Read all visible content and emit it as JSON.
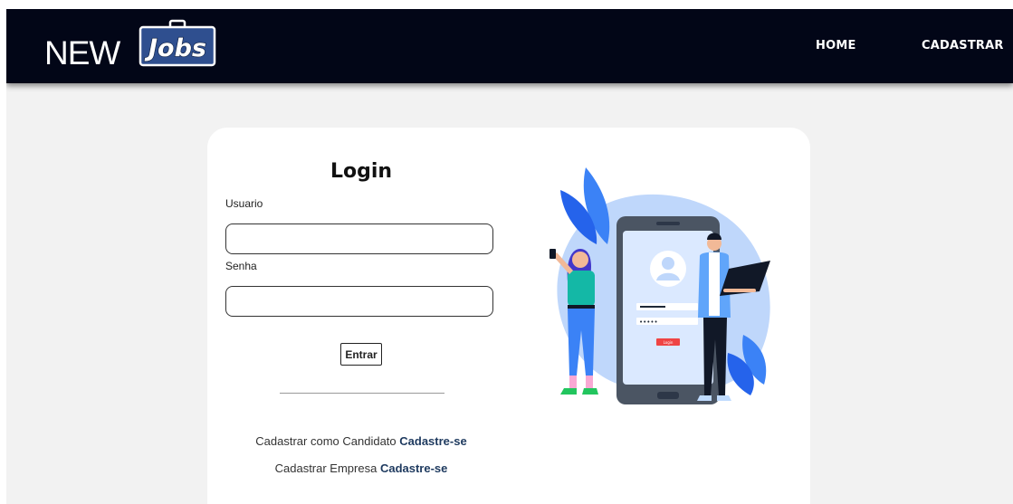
{
  "header": {
    "logo_text_new": "NEW",
    "logo_text_jobs": "Jobs",
    "nav": [
      {
        "label": "HOME"
      },
      {
        "label": "CADASTRAR"
      }
    ]
  },
  "login": {
    "title": "Login",
    "user_label": "Usuario",
    "user_value": "",
    "password_label": "Senha",
    "password_value": "",
    "submit_label": "Entrar"
  },
  "signup": {
    "candidate_text": "Cadastrar como Candidato",
    "candidate_link": "Cadastre-se",
    "company_text": "Cadastrar Empresa",
    "company_link": "Cadastre-se"
  },
  "illustration": {
    "icon": "login-illustration-icon",
    "button_text": "Login"
  },
  "colors": {
    "navbar_bg": "#020617",
    "page_bg": "#f2f2f2",
    "link_color": "#1e3a5f",
    "illustration_blue": "#3b82f6"
  }
}
